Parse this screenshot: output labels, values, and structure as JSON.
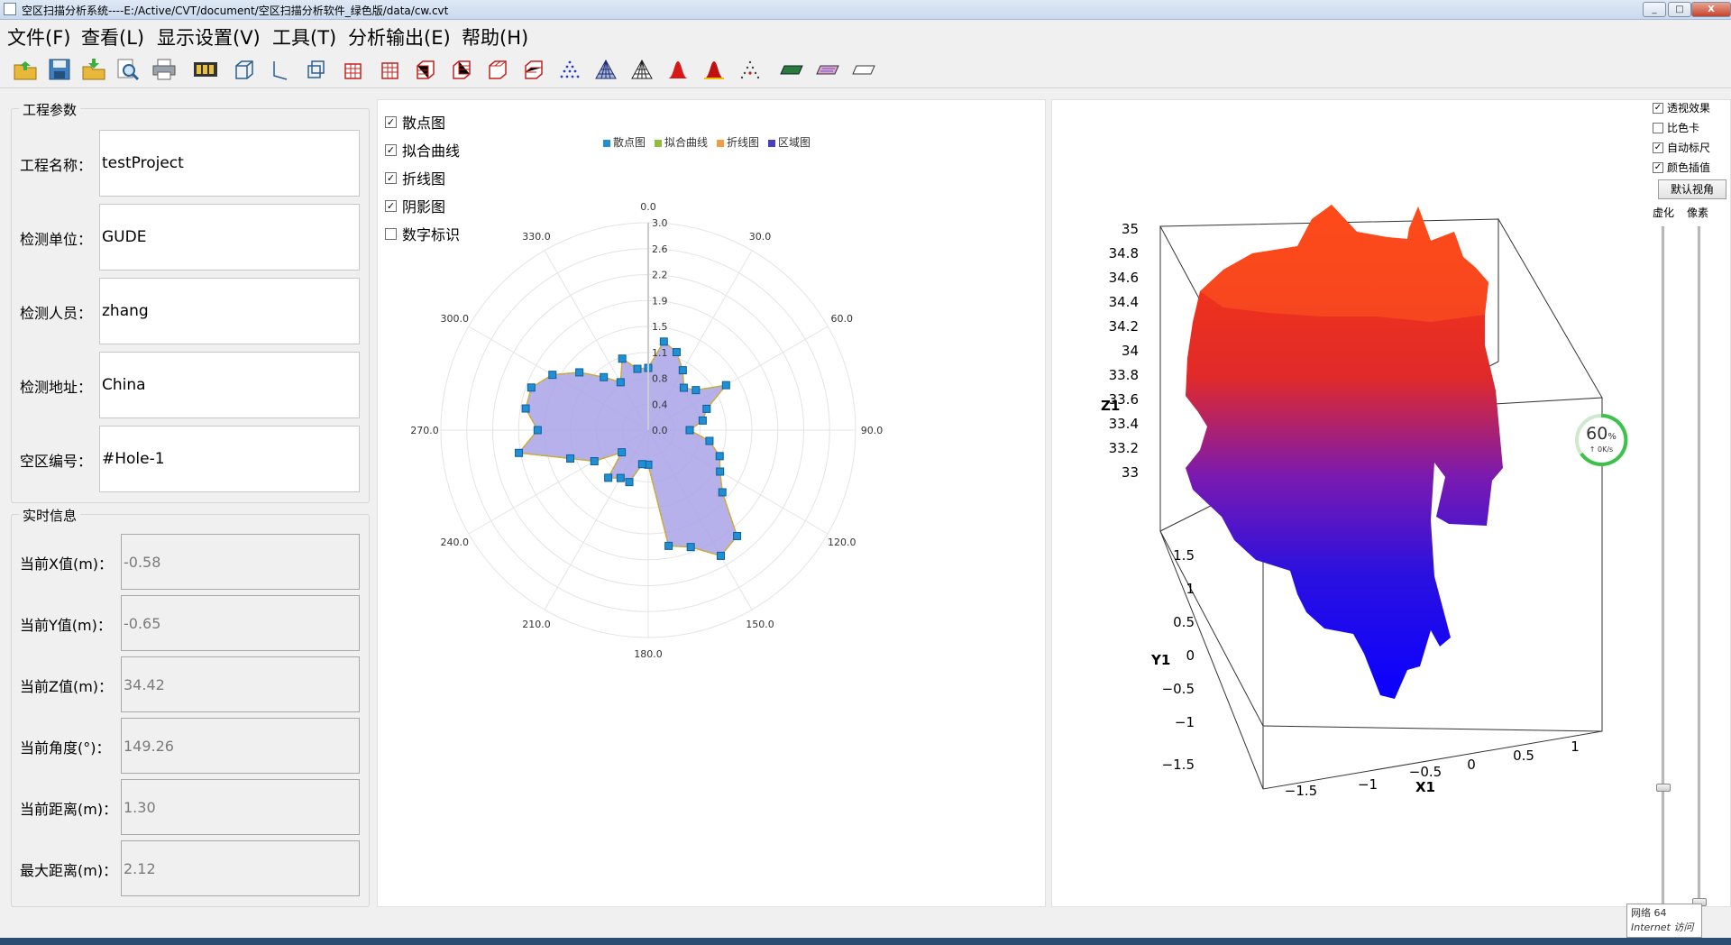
{
  "window": {
    "title": "空区扫描分析系统----E:/Active/CVT/document/空区扫描分析软件_绿色版/data/cw.cvt",
    "minimize": "_",
    "maximize": "□",
    "close": "X"
  },
  "menu": [
    "文件(F)",
    "查看(L)",
    "显示设置(V)",
    "工具(T)",
    "分析输出(E)",
    "帮助(H)"
  ],
  "toolbar_icons": [
    "open-folder-icon",
    "save-icon",
    "import-icon",
    "preview-icon",
    "print-icon",
    "film-icon",
    "cube-icon",
    "axis-icon",
    "cube-outline-icon",
    "grid-cube-icon",
    "grid-cube-2-icon",
    "grid-cube-3-icon",
    "grid-cube-4-icon",
    "grid-cube-5-icon",
    "grid-cube-6-icon",
    "point-cloud-icon",
    "mesh-icon",
    "mesh-2-icon",
    "red-peak-icon",
    "red-peak-2-icon",
    "scatter-peak-icon",
    "green-plane-icon",
    "pink-plane-icon",
    "white-plane-icon"
  ],
  "project": {
    "group_title": "工程参数",
    "fields": [
      {
        "label": "工程名称：",
        "value": "testProject"
      },
      {
        "label": "检测单位：",
        "value": "GUDE"
      },
      {
        "label": "检测人员：",
        "value": "zhang"
      },
      {
        "label": "检测地址：",
        "value": "China"
      },
      {
        "label": "空区编号：",
        "value": "#Hole-1"
      }
    ]
  },
  "realtime": {
    "group_title": "实时信息",
    "fields": [
      {
        "label": "当前X值(m)：",
        "value": "-0.58"
      },
      {
        "label": "当前Y值(m)：",
        "value": "-0.65"
      },
      {
        "label": "当前Z值(m)：",
        "value": "34.42"
      },
      {
        "label": "当前角度(°)：",
        "value": "149.26"
      },
      {
        "label": "当前距离(m)：",
        "value": "1.30"
      },
      {
        "label": "最大距离(m)：",
        "value": "2.12"
      }
    ]
  },
  "polar_checks": [
    {
      "label": "散点图",
      "checked": true
    },
    {
      "label": "拟合曲线",
      "checked": true
    },
    {
      "label": "折线图",
      "checked": true
    },
    {
      "label": "阴影图",
      "checked": true
    },
    {
      "label": "数字标识",
      "checked": false
    }
  ],
  "polar_legend": [
    {
      "label": "散点图",
      "color": "#1f8fd6"
    },
    {
      "label": "拟合曲线",
      "color": "#8fbf3f"
    },
    {
      "label": "折线图",
      "color": "#f0a040"
    },
    {
      "label": "区域图",
      "color": "#4a3fbf"
    }
  ],
  "view3d": {
    "options": [
      {
        "label": "透视效果",
        "checked": true
      },
      {
        "label": "比色卡",
        "checked": false
      },
      {
        "label": "自动标尺",
        "checked": true
      },
      {
        "label": "颜色插值",
        "checked": true
      }
    ],
    "default_view_button": "默认视角",
    "slider_labels": [
      "虚化",
      "像素"
    ],
    "z_label": "Z1",
    "y_label": "Y1",
    "x_label": "X1",
    "z_ticks": [
      "35",
      "34.8",
      "34.6",
      "34.4",
      "34.2",
      "34",
      "33.8",
      "33.6",
      "33.4",
      "33.2",
      "33"
    ],
    "y_ticks": [
      "1.5",
      "1",
      "0.5",
      "0",
      "−0.5",
      "−1",
      "−1.5"
    ],
    "x_ticks": [
      "−1.5",
      "−1",
      "−0.5",
      "0",
      "0.5",
      "1"
    ]
  },
  "network_badge": {
    "percent": "60",
    "unit": "%",
    "speed": "0K/s"
  },
  "tooltip": {
    "line1": "网络  64",
    "line2": "Internet 访问"
  },
  "chart_data": {
    "type": "polar-area",
    "angle_ticks": [
      "0.0",
      "30.0",
      "60.0",
      "90.0",
      "120.0",
      "150.0",
      "180.0",
      "210.0",
      "240.0",
      "270.0",
      "300.0",
      "330.0"
    ],
    "radial_ticks": [
      "0.0",
      "0.4",
      "0.8",
      "1.1",
      "1.5",
      "1.9",
      "2.2",
      "2.6",
      "3.0"
    ],
    "rmax": 3.0,
    "angles": [
      0,
      10,
      20,
      30,
      40,
      50,
      60,
      70,
      80,
      90,
      100,
      110,
      120,
      130,
      140,
      150,
      160,
      170,
      180,
      190,
      200,
      210,
      220,
      230,
      240,
      250,
      260,
      270,
      280,
      290,
      300,
      310,
      320,
      330,
      340,
      350
    ],
    "values": [
      0.9,
      1.3,
      1.2,
      1.0,
      0.8,
      0.9,
      1.3,
      0.9,
      0.8,
      0.6,
      0.9,
      1.1,
      1.2,
      1.4,
      2.0,
      2.1,
      1.8,
      1.7,
      0.5,
      0.5,
      0.8,
      0.8,
      0.9,
      0.5,
      0.9,
      1.2,
      1.9,
      1.6,
      1.8,
      1.8,
      1.6,
      1.3,
      1.0,
      0.8,
      1.1,
      0.9
    ]
  }
}
